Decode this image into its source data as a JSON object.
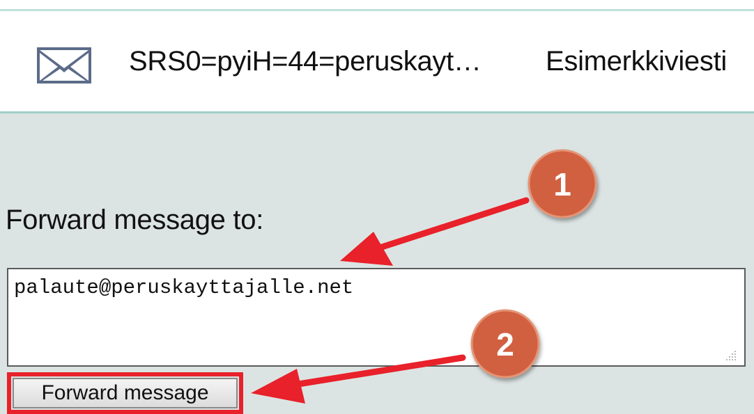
{
  "message_row": {
    "sender": "SRS0=pyiH=44=peruskayt…",
    "subject": "Esimerkkiviesti"
  },
  "forward": {
    "label": "Forward message to:",
    "recipient_value": "palaute@peruskayttajalle.net",
    "button_label": "Forward message"
  },
  "annotations": {
    "callouts": [
      "1",
      "2"
    ],
    "callout_color": "#d1603f",
    "arrow_color": "#e8212a"
  },
  "icons": {
    "message": "envelope-icon",
    "resize": "resize-grip-icon"
  },
  "colors": {
    "panel_background": "#dce4e3",
    "divider": "#9fcfc8",
    "highlight": "#e8212a"
  }
}
